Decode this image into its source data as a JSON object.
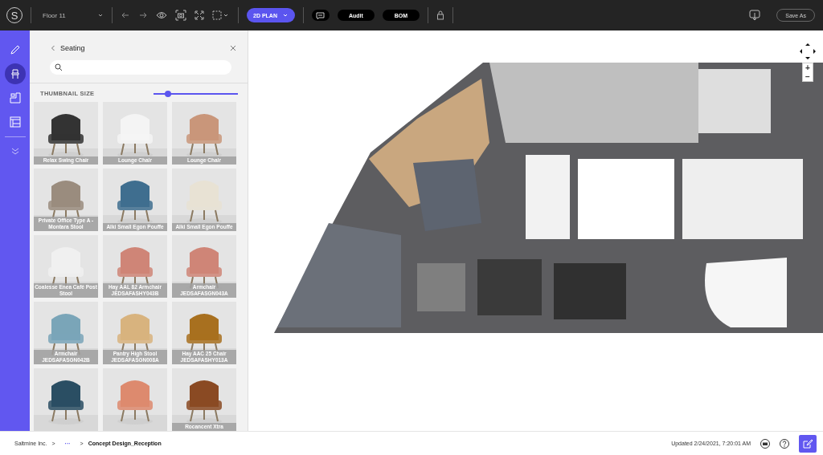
{
  "toolbar": {
    "logo": "S",
    "floor": "Floor 11",
    "view_mode": {
      "label": "2D PLAN",
      "selected": true
    },
    "buttons": [
      "Audit",
      "BOM"
    ],
    "save": "Save As"
  },
  "rail": [
    {
      "kind": "pencil",
      "selected": false
    },
    {
      "kind": "chair",
      "selected": true
    },
    {
      "kind": "rooms",
      "selected": false
    },
    {
      "kind": "layout",
      "selected": false
    },
    {
      "kind": "more",
      "selected": false
    }
  ],
  "panel": {
    "title": "Seating",
    "thumbnail_size": {
      "label": "THUMBNAIL SIZE",
      "level": 0.17
    },
    "items": [
      {
        "kind": "picture",
        "name": "Relax Swing Chair"
      },
      {
        "kind": "picture",
        "name": "Lounge Chair"
      },
      {
        "kind": "picture",
        "name": "Lounge Chair"
      },
      {
        "kind": "picture",
        "name": "Private Office Type A - Montara Stool"
      },
      {
        "kind": "picture",
        "name": "Alki Small Egon Pouffe"
      },
      {
        "kind": "picture",
        "name": "Alki Small Egon Pouffe"
      },
      {
        "kind": "picture",
        "name": "Coalesse Enea Café Post Stool"
      },
      {
        "kind": "picture",
        "name": "Hay AAL 82 Armchair",
        "code": "JEDSAFASHY043B"
      },
      {
        "kind": "picture",
        "name": "Armchair",
        "code": "JEDSAFASGN043A"
      },
      {
        "kind": "picture",
        "name": "Armchair",
        "code": "JEDSAFASGN042B"
      },
      {
        "kind": "picture",
        "name": "Pantry High Stool",
        "code": "JEDSAFASGN008A"
      },
      {
        "kind": "picture",
        "name": "Hay AAC 25 Chair",
        "code": "JEDSAFASHY013A"
      },
      {
        "kind": "picture"
      },
      {
        "kind": "picture"
      },
      {
        "kind": "picture",
        "name": "Rocancent Xtra"
      }
    ]
  },
  "canvas": {
    "zoom_in": "+",
    "zoom_out": "−"
  },
  "footer": {
    "crumbs": [
      {
        "kind": "link",
        "label": "Saltmine Inc."
      },
      {
        "kind": "sep",
        "label": ">"
      },
      {
        "kind": "more",
        "label": "···"
      },
      {
        "kind": "sep",
        "label": ">"
      },
      {
        "kind": "current",
        "label": "Concept Design_Reception"
      }
    ],
    "updated": "Updated 2/24/2021, 7:20:01 AM"
  }
}
